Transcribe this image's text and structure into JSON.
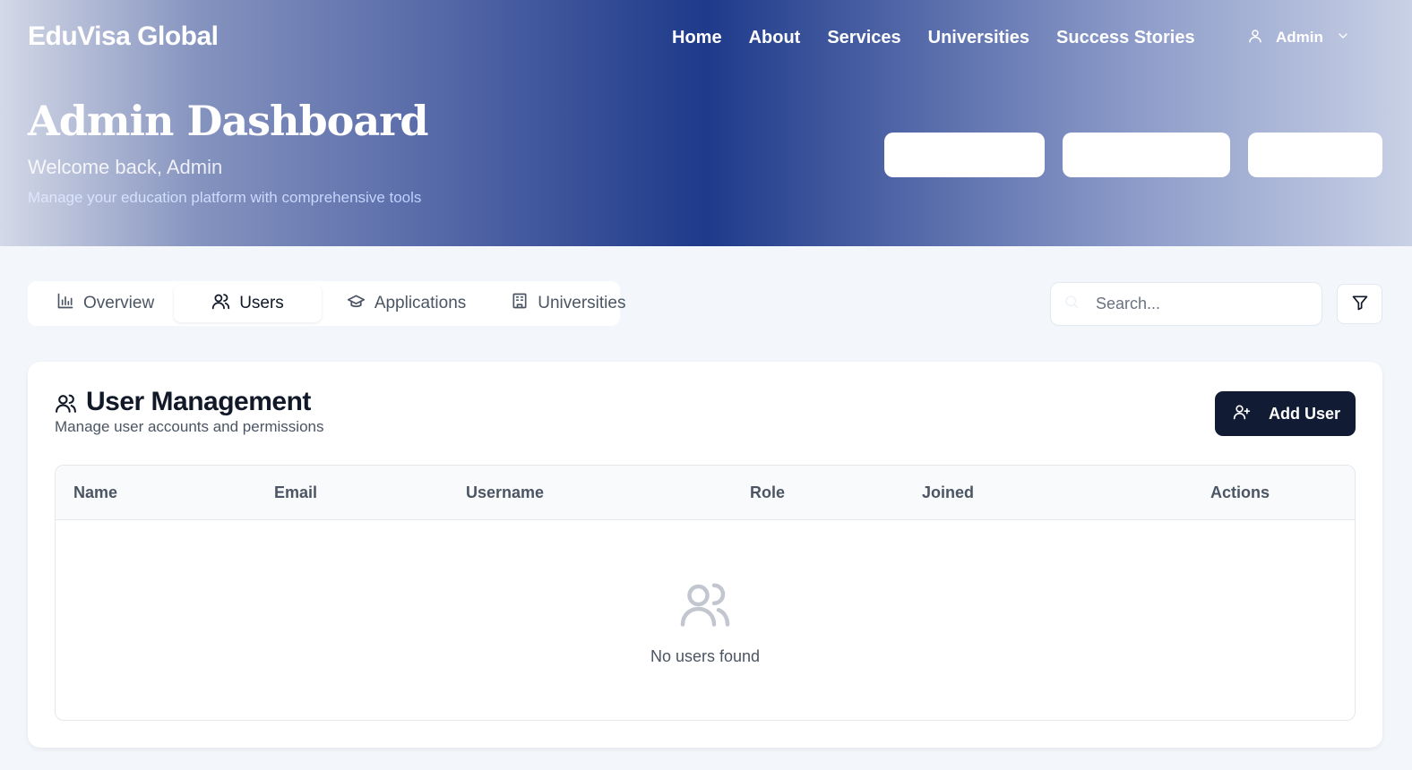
{
  "brand": "EduVisa Global",
  "nav": {
    "items": [
      "Home",
      "About",
      "Services",
      "Universities",
      "Success Stories"
    ],
    "user_label": "Admin",
    "user_icon": "user-icon",
    "dropdown_icon": "chevron-down-icon"
  },
  "hero": {
    "title": "Admin Dashboard",
    "welcome": "Welcome back, Admin",
    "tagline": "Manage your education platform with comprehensive tools",
    "action_buttons": [
      "",
      "",
      ""
    ]
  },
  "tabs": [
    {
      "label": "Overview",
      "icon": "bar-chart-icon",
      "active": false
    },
    {
      "label": "Users",
      "icon": "users-icon",
      "active": true
    },
    {
      "label": "Applications",
      "icon": "graduation-cap-icon",
      "active": false
    },
    {
      "label": "Universities",
      "icon": "building-icon",
      "active": false
    }
  ],
  "search": {
    "placeholder": "Search...",
    "value": "",
    "icon": "search-icon"
  },
  "filter": {
    "icon": "filter-icon"
  },
  "users_card": {
    "icon": "users-icon",
    "title": "User Management",
    "subtitle": "Manage user accounts and permissions",
    "add_button": {
      "label": "Add User",
      "icon": "user-plus-icon"
    },
    "columns": [
      "Name",
      "Email",
      "Username",
      "Role",
      "Joined",
      "Actions"
    ],
    "rows": [],
    "empty_state": {
      "icon": "users-icon",
      "message": "No users found"
    }
  },
  "colors": {
    "hero_gradient_center": "#1e3a8a",
    "primary_button": "#111c34",
    "page_background": "#f3f6fb"
  }
}
